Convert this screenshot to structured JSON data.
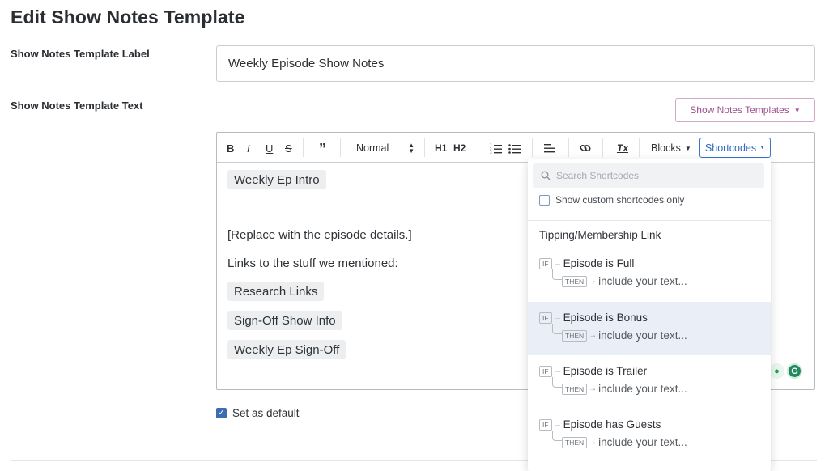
{
  "page": {
    "title": "Edit Show Notes Template"
  },
  "form": {
    "label_field_label": "Show Notes Template Label",
    "label_field_value": "Weekly Episode Show Notes",
    "text_field_label": "Show Notes Template Text",
    "templates_button": "Show Notes Templates",
    "default_checkbox_label": "Set as default",
    "default_checked": true
  },
  "toolbar": {
    "bold": "B",
    "italic": "I",
    "underline": "U",
    "strike": "S",
    "quote": "”",
    "format_select": "Normal",
    "h1": "H1",
    "h2": "H2",
    "link_icon": "link-icon",
    "clear_format": "Tx",
    "blocks": "Blocks",
    "shortcodes": "Shortcodes"
  },
  "editor": {
    "chip_intro": "Weekly Ep Intro",
    "line_replace": "[Replace with the episode details.]",
    "line_links": "Links to the stuff we mentioned:",
    "chip_research": "Research Links",
    "chip_signoff_info": "Sign-Off Show Info",
    "chip_signoff": "Weekly Ep Sign-Off"
  },
  "shortcodes_dropdown": {
    "search_placeholder": "Search Shortcodes",
    "custom_only_label": "Show custom shortcodes only",
    "items": [
      {
        "label": "Tipping/Membership Link"
      }
    ],
    "conditionals": [
      {
        "if_tag": "IF",
        "condition": "Episode is Full",
        "then_tag": "THEN",
        "then_text": "include your text..."
      },
      {
        "if_tag": "IF",
        "condition": "Episode is Bonus",
        "then_tag": "THEN",
        "then_text": "include your text..."
      },
      {
        "if_tag": "IF",
        "condition": "Episode is Trailer",
        "then_tag": "THEN",
        "then_text": "include your text..."
      },
      {
        "if_tag": "IF",
        "condition": "Episode has Guests",
        "then_tag": "THEN",
        "then_text": "include your text..."
      }
    ]
  },
  "colors": {
    "shortcodes_accent": "#3b76c9",
    "templates_accent": "#a0508f",
    "checkbox": "#3d6db0",
    "highlight_row": "#e9eef7"
  }
}
